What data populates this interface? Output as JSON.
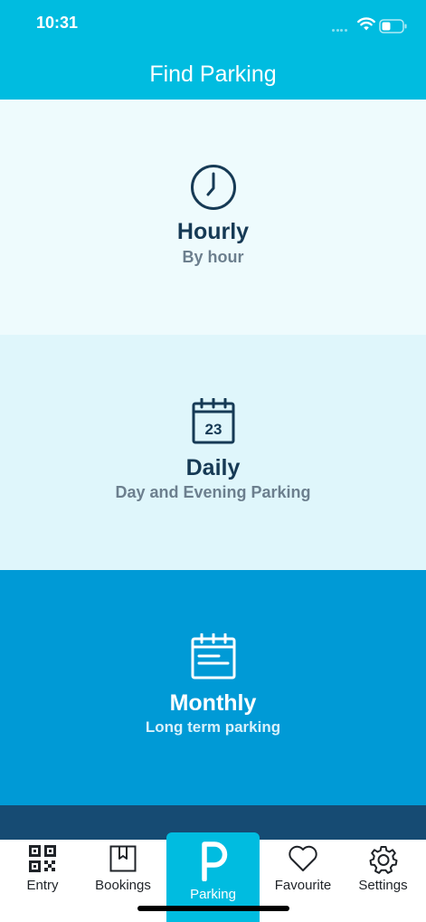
{
  "status_bar": {
    "time": "10:31"
  },
  "header": {
    "title": "Find Parking"
  },
  "options": [
    {
      "title": "Hourly",
      "subtitle": "By hour",
      "icon": "clock-icon"
    },
    {
      "title": "Daily",
      "subtitle": "Day and Evening Parking",
      "icon": "calendar-icon",
      "calendar_day": "23"
    },
    {
      "title": "Monthly",
      "subtitle": "Long term parking",
      "icon": "calendar-list-icon"
    }
  ],
  "tabs": [
    {
      "label": "Entry",
      "icon": "qr-code-icon"
    },
    {
      "label": "Bookings",
      "icon": "bookmark-icon"
    },
    {
      "label": "Parking",
      "icon": "parking-icon",
      "active": true
    },
    {
      "label": "Favourite",
      "icon": "heart-icon"
    },
    {
      "label": "Settings",
      "icon": "gear-icon"
    }
  ],
  "colors": {
    "accent": "#00bce0",
    "hourly_bg": "#eefbfd",
    "daily_bg": "#dff6fb",
    "monthly_bg": "#009ad6",
    "dark_band": "#164b73",
    "title_text": "#163a55",
    "subtitle_text": "#6c7f8e"
  }
}
